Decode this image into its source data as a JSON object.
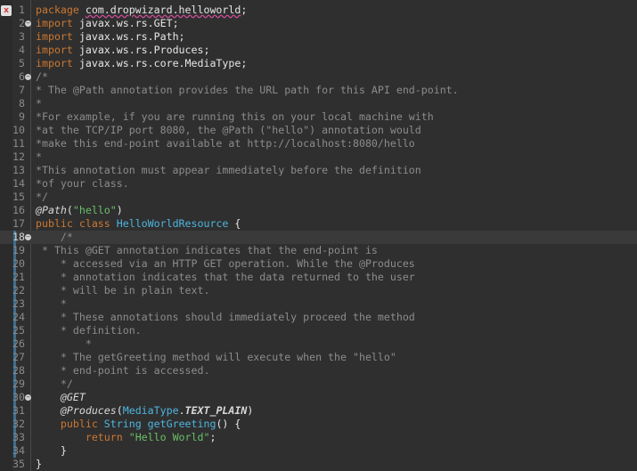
{
  "editor": {
    "error_marker": "x",
    "lines": [
      {
        "n": "1",
        "tokens": [
          [
            "kw",
            "package "
          ],
          [
            "err",
            "com.dropwizard.helloworld"
          ],
          [
            "txt",
            ";"
          ]
        ]
      },
      {
        "n": "2",
        "fold": true,
        "tokens": [
          [
            "kw",
            "import "
          ],
          [
            "txt",
            "javax.ws.rs.GET;"
          ]
        ]
      },
      {
        "n": "3",
        "tokens": [
          [
            "kw",
            "import "
          ],
          [
            "txt",
            "javax.ws.rs.Path;"
          ]
        ]
      },
      {
        "n": "4",
        "tokens": [
          [
            "kw",
            "import "
          ],
          [
            "txt",
            "javax.ws.rs.Produces;"
          ]
        ]
      },
      {
        "n": "5",
        "tokens": [
          [
            "kw",
            "import "
          ],
          [
            "txt",
            "javax.ws.rs.core.MediaType;"
          ]
        ]
      },
      {
        "n": "6",
        "fold": true,
        "tokens": [
          [
            "com",
            "/*"
          ]
        ]
      },
      {
        "n": "7",
        "tokens": [
          [
            "com",
            "* The @Path annotation provides the URL path for this API end-point."
          ]
        ]
      },
      {
        "n": "8",
        "tokens": [
          [
            "com",
            "*"
          ]
        ]
      },
      {
        "n": "9",
        "tokens": [
          [
            "com",
            "*For example, if you are running this on your local machine with"
          ]
        ]
      },
      {
        "n": "10",
        "tokens": [
          [
            "com",
            "*at the TCP/IP port 8080, the @Path (\"hello\") annotation would"
          ]
        ]
      },
      {
        "n": "11",
        "tokens": [
          [
            "com",
            "*make this end-point available at http://localhost:8080/hello"
          ]
        ]
      },
      {
        "n": "12",
        "tokens": [
          [
            "com",
            "*"
          ]
        ]
      },
      {
        "n": "13",
        "tokens": [
          [
            "com",
            "*This annotation must appear immediately before the definition"
          ]
        ]
      },
      {
        "n": "14",
        "tokens": [
          [
            "com",
            "*of your class."
          ]
        ]
      },
      {
        "n": "15",
        "tokens": [
          [
            "com",
            "*/"
          ]
        ]
      },
      {
        "n": "16",
        "tokens": [
          [
            "ann",
            "@Path"
          ],
          [
            "txt",
            "("
          ],
          [
            "str",
            "\"hello\""
          ],
          [
            "txt",
            ")"
          ]
        ]
      },
      {
        "n": "17",
        "tokens": [
          [
            "kw",
            "public class "
          ],
          [
            "type",
            "HelloWorldResource"
          ],
          [
            "txt",
            " {"
          ]
        ]
      },
      {
        "n": "18",
        "fold": true,
        "current": true,
        "tokens": [
          [
            "com",
            "    /*"
          ]
        ]
      },
      {
        "n": "19",
        "tokens": [
          [
            "com",
            " * This @GET annotation indicates that the end-point is"
          ]
        ]
      },
      {
        "n": "20",
        "tokens": [
          [
            "com",
            "    * accessed via an HTTP GET operation. While the @Produces"
          ]
        ]
      },
      {
        "n": "21",
        "tokens": [
          [
            "com",
            "    * annotation indicates that the data returned to the user"
          ]
        ]
      },
      {
        "n": "22",
        "tokens": [
          [
            "com",
            "    * will be in plain text."
          ]
        ]
      },
      {
        "n": "23",
        "tokens": [
          [
            "com",
            "    *"
          ]
        ]
      },
      {
        "n": "24",
        "tokens": [
          [
            "com",
            "    * These annotations should immediately proceed the method"
          ]
        ]
      },
      {
        "n": "25",
        "tokens": [
          [
            "com",
            "    * definition."
          ]
        ]
      },
      {
        "n": "26",
        "tokens": [
          [
            "com",
            "        *"
          ]
        ]
      },
      {
        "n": "27",
        "tokens": [
          [
            "com",
            "    * The getGreeting method will execute when the \"hello\""
          ]
        ]
      },
      {
        "n": "28",
        "tokens": [
          [
            "com",
            "    * end-point is accessed."
          ]
        ]
      },
      {
        "n": "29",
        "tokens": [
          [
            "com",
            "    */"
          ]
        ]
      },
      {
        "n": "30",
        "fold": true,
        "tokens": [
          [
            "txt",
            "    "
          ],
          [
            "ann",
            "@GET"
          ]
        ]
      },
      {
        "n": "31",
        "tokens": [
          [
            "txt",
            "    "
          ],
          [
            "ann",
            "@Produces"
          ],
          [
            "txt",
            "("
          ],
          [
            "type",
            "MediaType"
          ],
          [
            "txt",
            "."
          ],
          [
            "const",
            "TEXT_PLAIN"
          ],
          [
            "txt",
            ")"
          ]
        ]
      },
      {
        "n": "32",
        "tokens": [
          [
            "txt",
            "    "
          ],
          [
            "kw",
            "public "
          ],
          [
            "type",
            "String"
          ],
          [
            "txt",
            " "
          ],
          [
            "type",
            "getGreeting"
          ],
          [
            "txt",
            "() {"
          ]
        ]
      },
      {
        "n": "33",
        "tokens": [
          [
            "txt",
            "        "
          ],
          [
            "kw",
            "return "
          ],
          [
            "str",
            "\"Hello World\""
          ],
          [
            "txt",
            ";"
          ]
        ]
      },
      {
        "n": "34",
        "tokens": [
          [
            "txt",
            "    }"
          ]
        ]
      },
      {
        "n": "35",
        "tokens": [
          [
            "txt",
            "}"
          ]
        ]
      }
    ]
  }
}
